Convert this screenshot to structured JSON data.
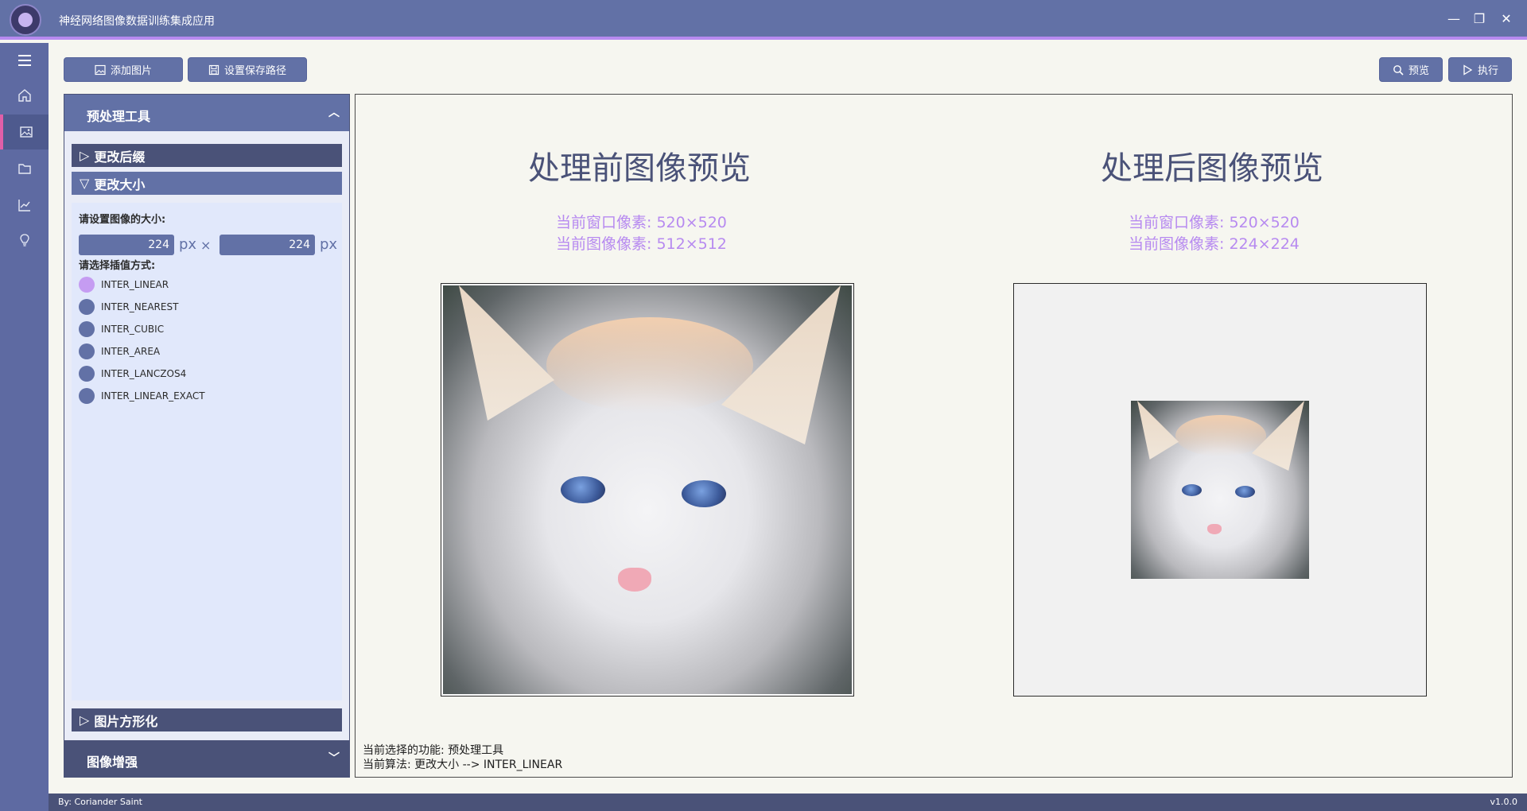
{
  "window": {
    "title": "神经网络图像数据训练集成应用",
    "controls": [
      "—",
      "❐",
      "✕"
    ]
  },
  "rail": {
    "items": [
      "menu-icon",
      "home-icon",
      "image-icon",
      "folder-icon",
      "chart-icon",
      "bulb-icon"
    ],
    "active_index": 2
  },
  "toolbar": {
    "add_image": "添加图片",
    "set_save_path": "设置保存路径",
    "preview": "预览",
    "execute": "执行"
  },
  "panel": {
    "title": "预处理工具",
    "sections": {
      "change_suffix": "更改后缀",
      "resize": "更改大小",
      "square": "图片方形化"
    },
    "resize": {
      "size_label": "请设置图像的大小:",
      "width": "224",
      "height": "224",
      "unit": "px",
      "times": "×",
      "interp_label": "请选择插值方式:",
      "methods": [
        "INTER_LINEAR",
        "INTER_NEAREST",
        "INTER_CUBIC",
        "INTER_AREA",
        "INTER_LANCZOS4",
        "INTER_LINEAR_EXACT"
      ],
      "selected": "INTER_LINEAR"
    },
    "footer_title": "图像增强"
  },
  "preview": {
    "before": {
      "title": "处理前图像预览",
      "window_px": "当前窗口像素: 520×520",
      "image_px": "当前图像像素: 512×512"
    },
    "after": {
      "title": "处理后图像预览",
      "window_px": "当前窗口像素: 520×520",
      "image_px": "当前图像像素: 224×224"
    }
  },
  "status": {
    "function": "当前选择的功能: 预处理工具",
    "algorithm": "当前算法: 更改大小 --> INTER_LINEAR"
  },
  "footer": {
    "author": "By: Coriander Saint",
    "version": "v1.0.0"
  },
  "colors": {
    "primary": "#6271a6",
    "dark": "#4a5278",
    "accent": "#b78af0",
    "active_marker": "#e05fa8"
  }
}
